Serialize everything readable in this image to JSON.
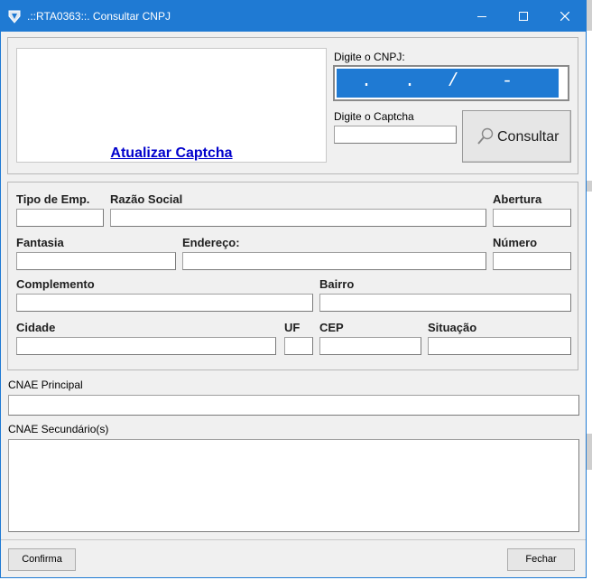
{
  "window": {
    "title": ".::RTA0363::. Consultar CNPJ",
    "icons": {
      "app": "app-logo-icon",
      "minimize": "minimize-icon",
      "maximize": "maximize-icon",
      "close": "close-icon"
    }
  },
  "captcha": {
    "refresh_link": "Atualizar Captcha"
  },
  "cnpj": {
    "label": "Digite o CNPJ:",
    "mask": "  .   .   /    -  "
  },
  "captcha_input": {
    "label": "Digite o Captcha",
    "value": ""
  },
  "consult_button": {
    "label": "Consultar",
    "icon": "search-icon"
  },
  "company": {
    "tipo_label": "Tipo de Emp.",
    "razao_label": "Razão Social",
    "abertura_label": "Abertura",
    "fantasia_label": "Fantasia",
    "endereco_label": "Endereço:",
    "numero_label": "Número",
    "complemento_label": "Complemento",
    "bairro_label": "Bairro",
    "cidade_label": "Cidade",
    "uf_label": "UF",
    "cep_label": "CEP",
    "situacao_label": "Situação"
  },
  "cnae": {
    "principal_label": "CNAE Principal",
    "secundario_label": "CNAE Secundário(s)"
  },
  "footer": {
    "confirm_label": "Confirma",
    "close_label": "Fechar"
  },
  "colors": {
    "titlebar": "#1f7ad3",
    "selection": "#1f7ad3",
    "link": "#0000cc"
  }
}
